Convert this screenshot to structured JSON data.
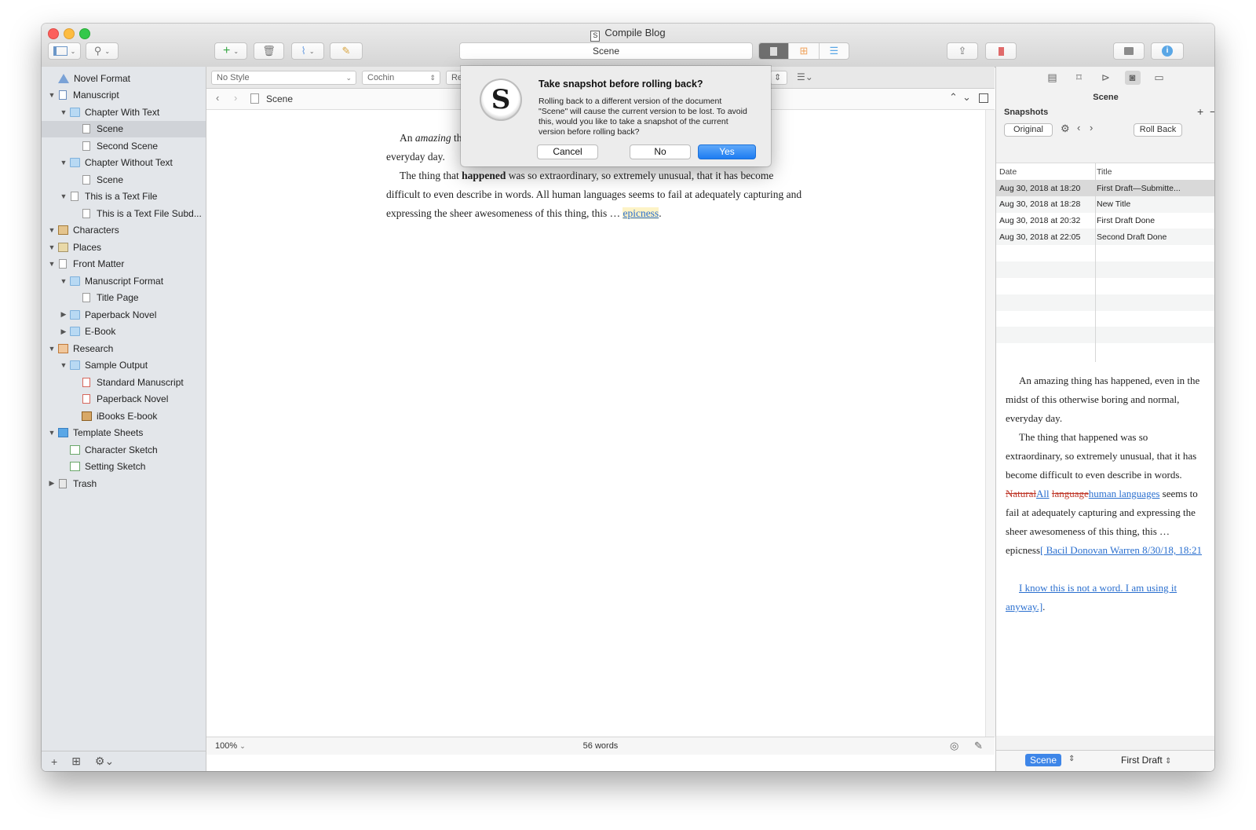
{
  "window": {
    "title": "Compile Blog"
  },
  "toolbar": {
    "scene_field": "Scene"
  },
  "binder": {
    "items": [
      {
        "label": "Novel Format",
        "indent": 0,
        "disc": "",
        "icon": "warn"
      },
      {
        "label": "Manuscript",
        "indent": 0,
        "disc": "▼",
        "icon": "ms"
      },
      {
        "label": "Chapter With Text",
        "indent": 1,
        "disc": "▼",
        "icon": "folder"
      },
      {
        "label": "Scene",
        "indent": 2,
        "disc": "",
        "icon": "doc",
        "selected": true
      },
      {
        "label": "Second Scene",
        "indent": 2,
        "disc": "",
        "icon": "doc"
      },
      {
        "label": "Chapter Without Text",
        "indent": 1,
        "disc": "▼",
        "icon": "folder"
      },
      {
        "label": "Scene",
        "indent": 2,
        "disc": "",
        "icon": "doc"
      },
      {
        "label": "This is a Text File",
        "indent": 1,
        "disc": "▼",
        "icon": "doc"
      },
      {
        "label": "This is a Text File Subd...",
        "indent": 2,
        "disc": "",
        "icon": "doc"
      },
      {
        "label": "Characters",
        "indent": 0,
        "disc": "▼",
        "icon": "char"
      },
      {
        "label": "Places",
        "indent": 0,
        "disc": "▼",
        "icon": "places"
      },
      {
        "label": "Front Matter",
        "indent": 0,
        "disc": "▼",
        "icon": "doc"
      },
      {
        "label": "Manuscript Format",
        "indent": 1,
        "disc": "▼",
        "icon": "folder"
      },
      {
        "label": "Title Page",
        "indent": 2,
        "disc": "",
        "icon": "doc"
      },
      {
        "label": "Paperback Novel",
        "indent": 1,
        "disc": "▶",
        "icon": "folder"
      },
      {
        "label": "E-Book",
        "indent": 1,
        "disc": "▶",
        "icon": "folder"
      },
      {
        "label": "Research",
        "indent": 0,
        "disc": "▼",
        "icon": "research"
      },
      {
        "label": "Sample Output",
        "indent": 1,
        "disc": "▼",
        "icon": "folder"
      },
      {
        "label": "Standard Manuscript",
        "indent": 2,
        "disc": "",
        "icon": "red"
      },
      {
        "label": "Paperback Novel",
        "indent": 2,
        "disc": "",
        "icon": "red"
      },
      {
        "label": "iBooks E-book",
        "indent": 2,
        "disc": "",
        "icon": "img"
      },
      {
        "label": "Template Sheets",
        "indent": 0,
        "disc": "▼",
        "icon": "template"
      },
      {
        "label": "Character Sketch",
        "indent": 1,
        "disc": "",
        "icon": "sketch"
      },
      {
        "label": "Setting Sketch",
        "indent": 1,
        "disc": "",
        "icon": "sketch"
      },
      {
        "label": "Trash",
        "indent": 0,
        "disc": "▶",
        "icon": "trash"
      }
    ]
  },
  "format_bar": {
    "style": "No Style",
    "font": "Cochin",
    "font_weight_partial": "Re"
  },
  "editor": {
    "header_title": "Scene",
    "para1_start": "An ",
    "para1_em": "amazing",
    "para1_rest": " thi",
    "para1_line2": "everyday day.",
    "para2_start": "The thing that ",
    "para2_bold": "happened",
    "para2_rest": " was so extraordinary, so extremely unusual, that it has become difficult to even describe in words. All human languages seems to fail at adequately capturing and expressing the sheer awesomeness of this thing, this … ",
    "para2_link": "epicness",
    "para2_end": ".",
    "zoom": "100%",
    "word_count": "56 words"
  },
  "inspector": {
    "title": "Scene",
    "section": "Snapshots",
    "original_button": "Original",
    "rollback_button": "Roll Back",
    "columns": [
      "Date",
      "Title"
    ],
    "snapshots": [
      {
        "date": "Aug 30, 2018 at 18:20",
        "title": "First Draft—Submitte..."
      },
      {
        "date": "Aug 30, 2018 at 18:28",
        "title": "New Title"
      },
      {
        "date": "Aug 30, 2018 at 20:32",
        "title": "First Draft Done"
      },
      {
        "date": "Aug 30, 2018 at 22:05",
        "title": "Second Draft Done"
      }
    ],
    "preview": {
      "p1": "An amazing thing has happened, even in the midst of this otherwise boring and normal, everyday day.",
      "p2_start": "The thing that happened was so extraordinary, so extremely unusual, that it has become difficult to even describe in words. ",
      "del1": "Natural",
      "ins1": "All",
      "space1": " ",
      "del2": "language",
      "ins2": "human languages",
      "p2_mid": " seems to fail at adequately capturing and expressing the sheer awesomeness of this thing, this … epicness",
      "comment1": "[ Bacil Donovan Warren 8/30/18, 18:21",
      "comment2": "I know this is not a word. I am using it anyway.]",
      "end": "."
    },
    "footer_label": "Scene",
    "footer_status": "First Draft"
  },
  "dialog": {
    "title": "Take snapshot before rolling back?",
    "message": "Rolling back to a different version of the document \"Scene\" will cause the current version to be lost. To avoid this, would you like to take a snapshot of the current version before rolling back?",
    "cancel": "Cancel",
    "no": "No",
    "yes": "Yes"
  },
  "colors": {
    "accent": "#1d7cf2",
    "selection": "#d0d3d8",
    "deletion": "#c0392b",
    "insertion": "#2a6fcf"
  }
}
